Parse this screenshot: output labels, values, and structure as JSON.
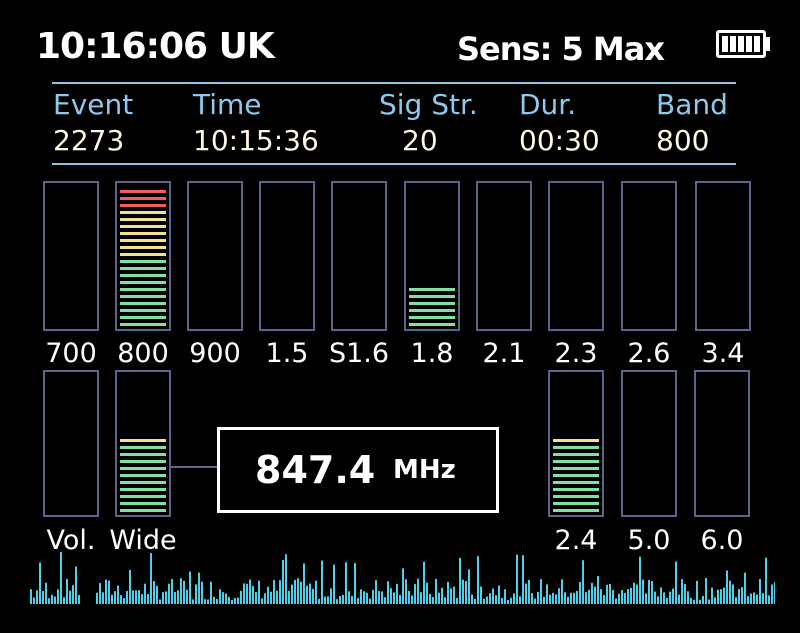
{
  "header": {
    "clock": "10:16:06 UK",
    "sensitivity": "Sens: 5 Max",
    "battery_icon": "battery-full-icon"
  },
  "event": {
    "headers": [
      "Event",
      "Time",
      "Sig Str.",
      "Dur.",
      "Band"
    ],
    "values": [
      "2273",
      "10:15:36",
      "20",
      "00:30",
      "800"
    ]
  },
  "bands_top": [
    {
      "label": "700",
      "level": 0
    },
    {
      "label": "800",
      "level": 1.0
    },
    {
      "label": "900",
      "level": 0
    },
    {
      "label": "1.5",
      "level": 0
    },
    {
      "label": "S1.6",
      "level": 0
    },
    {
      "label": "1.8",
      "level": 0.3
    },
    {
      "label": "2.1",
      "level": 0
    },
    {
      "label": "2.3",
      "level": 0
    },
    {
      "label": "2.6",
      "level": 0
    },
    {
      "label": "3.4",
      "level": 0
    }
  ],
  "bands_bottom": [
    {
      "label": "Vol.",
      "level": 0
    },
    {
      "label": "Wide",
      "level": 0.55
    },
    {
      "label": "2.4",
      "level": 0.55
    },
    {
      "label": "5.0",
      "level": 0
    },
    {
      "label": "6.0",
      "level": 0
    }
  ],
  "frequency": {
    "value": "847.4",
    "unit": "MHz"
  },
  "colors": {
    "bar_outline": "#5a648c",
    "header_text": "#8ec8ec",
    "value_text": "#fff7de",
    "spectrum": "#4fd0e8",
    "level_low": "#7fe0a0",
    "level_mid": "#f0e090",
    "level_high": "#f06060"
  }
}
